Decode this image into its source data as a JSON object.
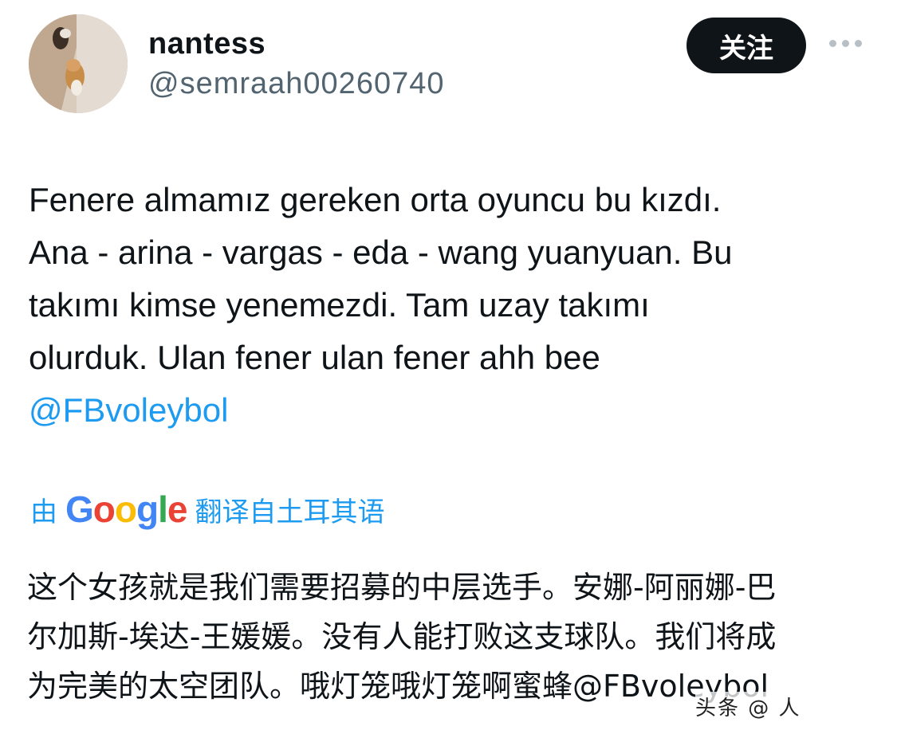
{
  "author": {
    "display_name": "nantess",
    "handle": "@semraah00260740"
  },
  "follow_button": {
    "label": "关注"
  },
  "tweet": {
    "lines": [
      "Fenere almamız gereken orta oyuncu bu kızdı.",
      "Ana - arina - vargas - eda - wang yuanyuan. Bu",
      "takımı kimse yenemezdi. Tam uzay takımı",
      "olurduk. Ulan fener ulan fener ahh bee"
    ],
    "mention": "@FBvoleybol"
  },
  "translation": {
    "prefix": "由",
    "provider": "Google",
    "suffix": "翻译自土耳其语",
    "lines": [
      "这个女孩就是我们需要招募的中层选手。安娜-阿丽娜-巴",
      "尔加斯-埃达-王媛媛。没有人能打败这支球队。我们将成",
      "为完美的太空团队。哦灯笼哦灯笼啊蜜蜂@FBvoleybol"
    ]
  },
  "watermark": "头条 @ 人",
  "colors": {
    "link": "#1d9bf0",
    "handle": "#536471",
    "follow_bg": "#0f1419",
    "text": "#0f1419"
  }
}
